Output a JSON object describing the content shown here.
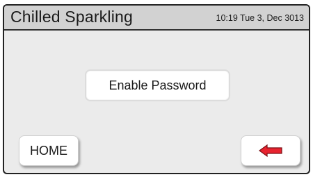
{
  "header": {
    "title": "Chilled Sparkling",
    "datetime": "10:19 Tue 3, Dec 3013"
  },
  "main": {
    "enable_password_label": "Enable Password"
  },
  "footer": {
    "home_label": "HOME",
    "back_icon": "left-arrow-icon"
  },
  "colors": {
    "header_bg": "#d2d2d2",
    "screen_bg": "#ebebeb",
    "arrow": "#e8232f"
  }
}
